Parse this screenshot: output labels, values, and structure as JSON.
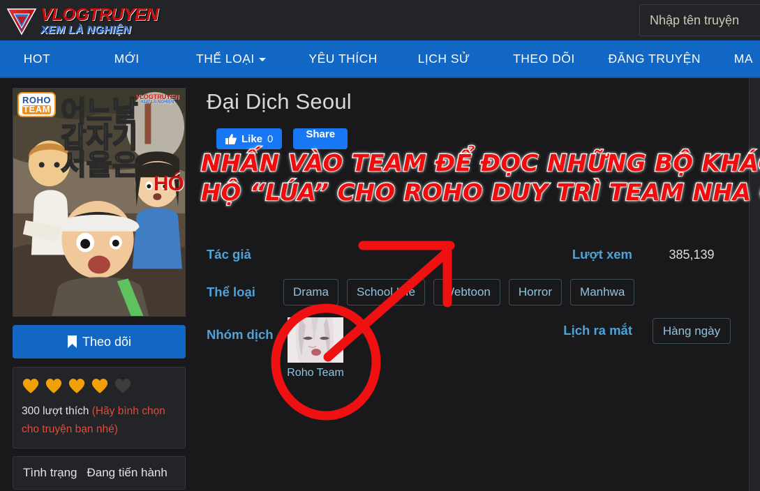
{
  "site": {
    "logo_top": "VLOGTRUYEN",
    "logo_bottom": "XEM LÀ NGHIỆN"
  },
  "search": {
    "placeholder": "Nhập tên truyện",
    "value": ""
  },
  "nav": {
    "items": [
      {
        "label": "HOT",
        "has_caret": false
      },
      {
        "label": "MỚI",
        "has_caret": false
      },
      {
        "label": "THỂ LOẠI",
        "has_caret": true
      },
      {
        "label": "YÊU THÍCH",
        "has_caret": false
      },
      {
        "label": "LỊCH SỬ",
        "has_caret": false
      },
      {
        "label": "THEO DÕI",
        "has_caret": false
      },
      {
        "label": "ĐĂNG TRUYỆN",
        "has_caret": false
      },
      {
        "label": "MA",
        "has_caret": false
      }
    ]
  },
  "sidebar": {
    "cover": {
      "title_korean_line1": "어느날",
      "title_korean_line2": "갑자기",
      "title_korean_line3": "서울은",
      "team_badge_line1": "ROHO",
      "team_badge_line2": "TEAM",
      "watermark_line1": "VLOGTRUYEN",
      "watermark_line2": "XEM LÀ NGHIỆN",
      "corner_text": "HÓ"
    },
    "follow_button": "Theo dõi",
    "rating": {
      "hearts_filled": 4,
      "hearts_total": 5,
      "likes_text": "300 lượt thích",
      "vote_hint": "(Hãy bình chọn cho truyện bạn nhé)"
    },
    "status": {
      "label": "Tình trạng",
      "value": "Đang tiến hành"
    }
  },
  "detail": {
    "title": "Đại Dịch Seoul",
    "social": {
      "like_label": "Like",
      "like_count": "0",
      "share_label": "Share"
    },
    "banner": {
      "line1": "NHẤN VÀO TEAM ĐỂ ĐỌC NHỮNG BỘ KHÁC ỦNG",
      "line2": "HỘ “LÚA” CHO ROHO DUY TRÌ TEAM NHA CẢ NHÀ!!"
    },
    "author": {
      "label": "Tác giả",
      "value": ""
    },
    "views": {
      "label": "Lượt xem",
      "value": "385,139"
    },
    "genre": {
      "label": "Thể loại",
      "tags": [
        "Drama",
        "School Life",
        "Webtoon",
        "Horror",
        "Manhwa"
      ]
    },
    "team": {
      "label": "Nhóm dịch",
      "name": "Roho Team"
    },
    "schedule": {
      "label": "Lịch ra mắt",
      "value": "Hàng ngày"
    }
  },
  "colors": {
    "nav_blue": "#1266c4",
    "accent_blue": "#4ea3d6",
    "annotation_red": "#f00c0c",
    "heart_orange": "#f2a007",
    "background": "#19191b"
  }
}
